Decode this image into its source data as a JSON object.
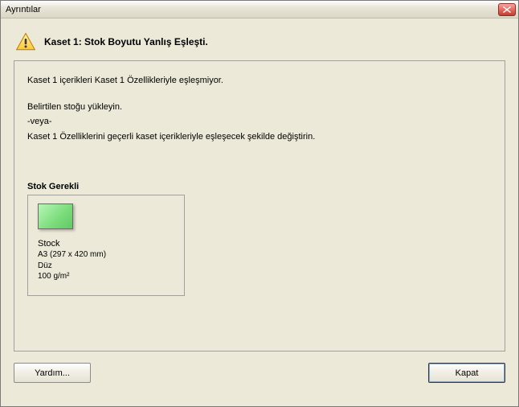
{
  "window": {
    "title": "Ayrıntılar"
  },
  "header": {
    "title": "Kaset 1: Stok Boyutu Yanlış Eşleşti."
  },
  "message": {
    "line1": "Kaset 1 içerikleri Kaset 1 Özellikleriyle eşleşmiyor.",
    "line2": "Belirtilen stoğu yükleyin.",
    "line3": "-veya-",
    "line4": "Kaset 1 Özelliklerini geçerli kaset içerikleriyle eşleşecek şekilde değiştirin."
  },
  "stock": {
    "section_label": "Stok Gerekli",
    "name": "Stock",
    "size": "A3 (297 x 420 mm)",
    "type": "Düz",
    "weight": "100 g/m²",
    "swatch_color": "#7adb7a"
  },
  "buttons": {
    "help": "Yardım...",
    "close": "Kapat"
  }
}
